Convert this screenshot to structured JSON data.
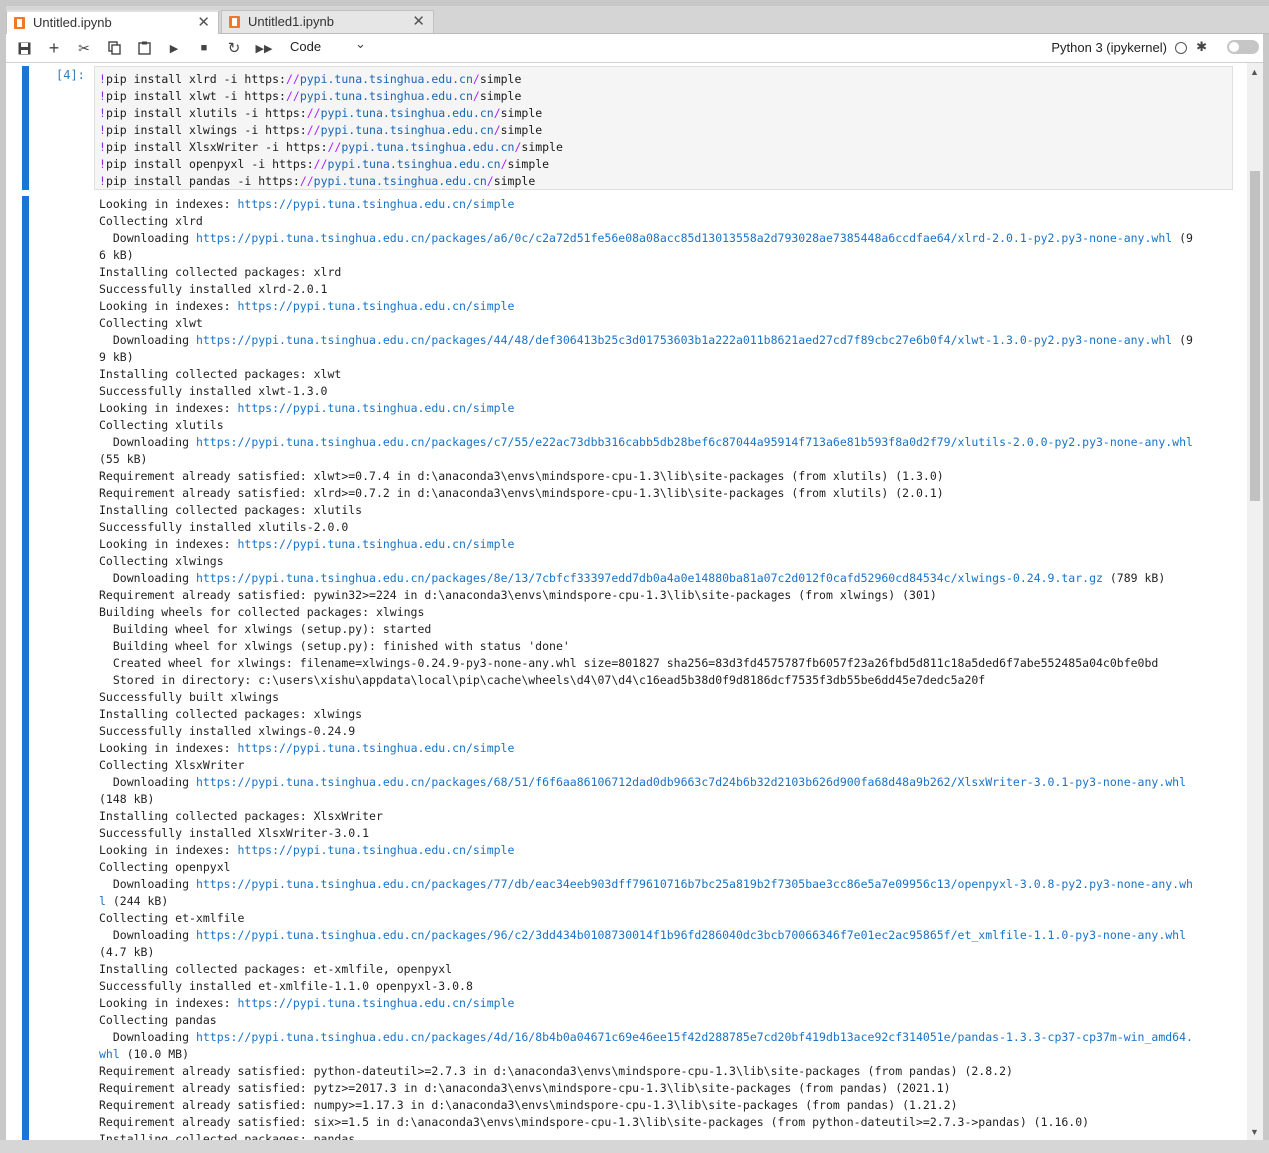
{
  "tabs": [
    {
      "label": "Untitled.ipynb",
      "close": "✕"
    },
    {
      "label": "Untitled1.ipynb",
      "close": "✕"
    }
  ],
  "toolbar": {
    "cell_type": "Code",
    "kernel": "Python 3 (ipykernel)"
  },
  "cell": {
    "prompt": "[4]:",
    "input_lines": [
      [
        "pip install xlrd -i https:",
        "//",
        "pypi.tuna.tsinghua.edu.cn",
        "/",
        "simple"
      ],
      [
        "pip install xlwt -i https:",
        "//",
        "pypi.tuna.tsinghua.edu.cn",
        "/",
        "simple"
      ],
      [
        "pip install xlutils -i https:",
        "//",
        "pypi.tuna.tsinghua.edu.cn",
        "/",
        "simple"
      ],
      [
        "pip install xlwings -i https:",
        "//",
        "pypi.tuna.tsinghua.edu.cn",
        "/",
        "simple"
      ],
      [
        "pip install XlsxWriter -i https:",
        "//",
        "pypi.tuna.tsinghua.edu.cn",
        "/",
        "simple"
      ],
      [
        "pip install openpyxl -i https:",
        "//",
        "pypi.tuna.tsinghua.edu.cn",
        "/",
        "simple"
      ],
      [
        "pip install pandas -i https:",
        "//",
        "pypi.tuna.tsinghua.edu.cn",
        "/",
        "simple"
      ]
    ],
    "bang": "!"
  },
  "output_lines": [
    [
      "Looking in indexes: ",
      "https://pypi.tuna.tsinghua.edu.cn/simple",
      ""
    ],
    [
      "Collecting xlrd",
      "",
      ""
    ],
    [
      "  Downloading ",
      "https://pypi.tuna.tsinghua.edu.cn/packages/a6/0c/c2a72d51fe56e08a08acc85d13013558a2d793028ae7385448a6ccdfae64/xlrd-2.0.1-py2.py3-none-any.whl",
      " (9"
    ],
    [
      "6 kB)",
      "",
      ""
    ],
    [
      "Installing collected packages: xlrd",
      "",
      ""
    ],
    [
      "Successfully installed xlrd-2.0.1",
      "",
      ""
    ],
    [
      "Looking in indexes: ",
      "https://pypi.tuna.tsinghua.edu.cn/simple",
      ""
    ],
    [
      "Collecting xlwt",
      "",
      ""
    ],
    [
      "  Downloading ",
      "https://pypi.tuna.tsinghua.edu.cn/packages/44/48/def306413b25c3d01753603b1a222a011b8621aed27cd7f89cbc27e6b0f4/xlwt-1.3.0-py2.py3-none-any.whl",
      " (9"
    ],
    [
      "9 kB)",
      "",
      ""
    ],
    [
      "Installing collected packages: xlwt",
      "",
      ""
    ],
    [
      "Successfully installed xlwt-1.3.0",
      "",
      ""
    ],
    [
      "Looking in indexes: ",
      "https://pypi.tuna.tsinghua.edu.cn/simple",
      ""
    ],
    [
      "Collecting xlutils",
      "",
      ""
    ],
    [
      "  Downloading ",
      "https://pypi.tuna.tsinghua.edu.cn/packages/c7/55/e22ac73dbb316cabb5db28bef6c87044a95914f713a6e81b593f8a0d2f79/xlutils-2.0.0-py2.py3-none-any.whl",
      ""
    ],
    [
      "(55 kB)",
      "",
      ""
    ],
    [
      "Requirement already satisfied: xlwt>=0.7.4 in d:\\anaconda3\\envs\\mindspore-cpu-1.3\\lib\\site-packages (from xlutils) (1.3.0)",
      "",
      ""
    ],
    [
      "Requirement already satisfied: xlrd>=0.7.2 in d:\\anaconda3\\envs\\mindspore-cpu-1.3\\lib\\site-packages (from xlutils) (2.0.1)",
      "",
      ""
    ],
    [
      "Installing collected packages: xlutils",
      "",
      ""
    ],
    [
      "Successfully installed xlutils-2.0.0",
      "",
      ""
    ],
    [
      "Looking in indexes: ",
      "https://pypi.tuna.tsinghua.edu.cn/simple",
      ""
    ],
    [
      "Collecting xlwings",
      "",
      ""
    ],
    [
      "  Downloading ",
      "https://pypi.tuna.tsinghua.edu.cn/packages/8e/13/7cbfcf33397edd7db0a4a0e14880ba81a07c2d012f0cafd52960cd84534c/xlwings-0.24.9.tar.gz",
      " (789 kB)"
    ],
    [
      "Requirement already satisfied: pywin32>=224 in d:\\anaconda3\\envs\\mindspore-cpu-1.3\\lib\\site-packages (from xlwings) (301)",
      "",
      ""
    ],
    [
      "Building wheels for collected packages: xlwings",
      "",
      ""
    ],
    [
      "  Building wheel for xlwings (setup.py): started",
      "",
      ""
    ],
    [
      "  Building wheel for xlwings (setup.py): finished with status 'done'",
      "",
      ""
    ],
    [
      "  Created wheel for xlwings: filename=xlwings-0.24.9-py3-none-any.whl size=801827 sha256=83d3fd4575787fb6057f23a26fbd5d811c18a5ded6f7abe552485a04c0bfe0bd",
      "",
      ""
    ],
    [
      "  Stored in directory: c:\\users\\xishu\\appdata\\local\\pip\\cache\\wheels\\d4\\07\\d4\\c16ead5b38d0f9d8186dcf7535f3db55be6dd45e7dedc5a20f",
      "",
      ""
    ],
    [
      "Successfully built xlwings",
      "",
      ""
    ],
    [
      "Installing collected packages: xlwings",
      "",
      ""
    ],
    [
      "Successfully installed xlwings-0.24.9",
      "",
      ""
    ],
    [
      "Looking in indexes: ",
      "https://pypi.tuna.tsinghua.edu.cn/simple",
      ""
    ],
    [
      "Collecting XlsxWriter",
      "",
      ""
    ],
    [
      "  Downloading ",
      "https://pypi.tuna.tsinghua.edu.cn/packages/68/51/f6f6aa86106712dad0db9663c7d24b6b32d2103b626d900fa68d48a9b262/XlsxWriter-3.0.1-py3-none-any.whl",
      ""
    ],
    [
      "(148 kB)",
      "",
      ""
    ],
    [
      "Installing collected packages: XlsxWriter",
      "",
      ""
    ],
    [
      "Successfully installed XlsxWriter-3.0.1",
      "",
      ""
    ],
    [
      "Looking in indexes: ",
      "https://pypi.tuna.tsinghua.edu.cn/simple",
      ""
    ],
    [
      "Collecting openpyxl",
      "",
      ""
    ],
    [
      "  Downloading ",
      "https://pypi.tuna.tsinghua.edu.cn/packages/77/db/eac34eeb903dff79610716b7bc25a819b2f7305bae3cc86e5a7e09956c13/openpyxl-3.0.8-py2.py3-none-any.wh",
      ""
    ],
    [
      "",
      "l",
      " (244 kB)"
    ],
    [
      "Collecting et-xmlfile",
      "",
      ""
    ],
    [
      "  Downloading ",
      "https://pypi.tuna.tsinghua.edu.cn/packages/96/c2/3dd434b0108730014f1b96fd286040dc3bcb70066346f7e01ec2ac95865f/et_xmlfile-1.1.0-py3-none-any.whl",
      ""
    ],
    [
      "(4.7 kB)",
      "",
      ""
    ],
    [
      "Installing collected packages: et-xmlfile, openpyxl",
      "",
      ""
    ],
    [
      "Successfully installed et-xmlfile-1.1.0 openpyxl-3.0.8",
      "",
      ""
    ],
    [
      "Looking in indexes: ",
      "https://pypi.tuna.tsinghua.edu.cn/simple",
      ""
    ],
    [
      "Collecting pandas",
      "",
      ""
    ],
    [
      "  Downloading ",
      "https://pypi.tuna.tsinghua.edu.cn/packages/4d/16/8b4b0a04671c69e46ee15f42d288785e7cd20bf419db13ace92cf314051e/pandas-1.3.3-cp37-cp37m-win_amd64.",
      ""
    ],
    [
      "",
      "whl",
      " (10.0 MB)"
    ],
    [
      "Requirement already satisfied: python-dateutil>=2.7.3 in d:\\anaconda3\\envs\\mindspore-cpu-1.3\\lib\\site-packages (from pandas) (2.8.2)",
      "",
      ""
    ],
    [
      "Requirement already satisfied: pytz>=2017.3 in d:\\anaconda3\\envs\\mindspore-cpu-1.3\\lib\\site-packages (from pandas) (2021.1)",
      "",
      ""
    ],
    [
      "Requirement already satisfied: numpy>=1.17.3 in d:\\anaconda3\\envs\\mindspore-cpu-1.3\\lib\\site-packages (from pandas) (1.21.2)",
      "",
      ""
    ],
    [
      "Requirement already satisfied: six>=1.5 in d:\\anaconda3\\envs\\mindspore-cpu-1.3\\lib\\site-packages (from python-dateutil>=2.7.3->pandas) (1.16.0)",
      "",
      ""
    ],
    [
      "Installing collected packages: pandas",
      "",
      ""
    ]
  ]
}
